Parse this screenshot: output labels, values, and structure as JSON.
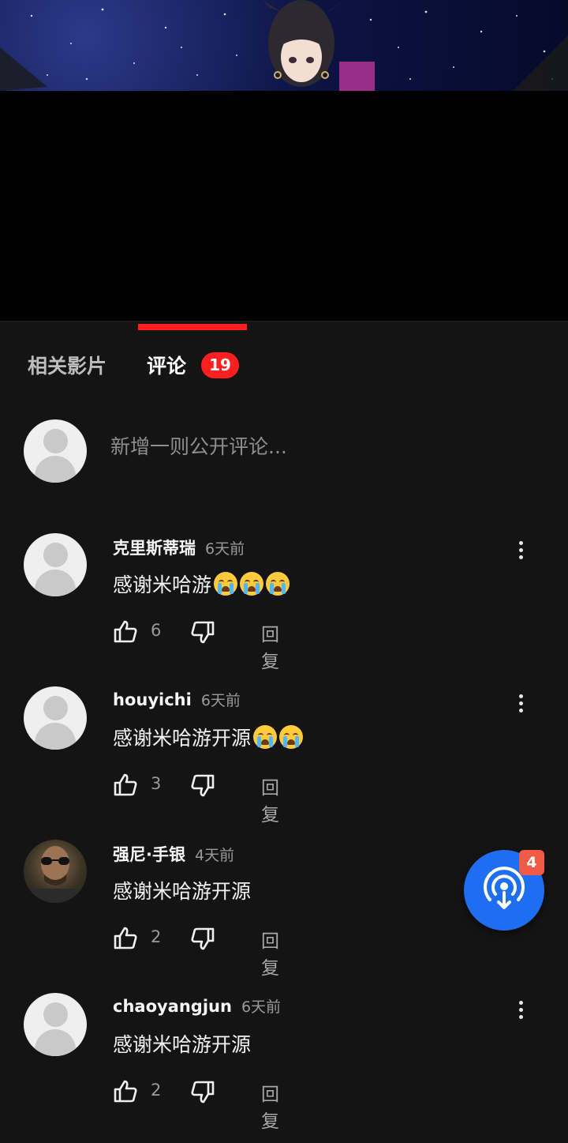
{
  "tabs": {
    "related": "相关影片",
    "comments": "评论",
    "comment_count": "19"
  },
  "compose": {
    "placeholder": "新增一则公开评论..."
  },
  "comments": [
    {
      "author": "克里斯蒂瑞",
      "time": "6天前",
      "text": "感谢米哈游",
      "emoji_count": 3,
      "likes": "6",
      "reply": "回复",
      "avatar": "default-avatar"
    },
    {
      "author": "houyichi",
      "time": "6天前",
      "text": "感谢米哈游开源",
      "emoji_count": 2,
      "likes": "3",
      "reply": "回复",
      "avatar": "default-avatar"
    },
    {
      "author": "强尼·手银",
      "time": "4天前",
      "text": "感谢米哈游开源",
      "emoji_count": 0,
      "likes": "2",
      "reply": "回复",
      "avatar": "photo-avatar"
    },
    {
      "author": "chaoyangjun",
      "time": "6天前",
      "text": "感谢米哈游开源",
      "emoji_count": 0,
      "likes": "2",
      "reply": "回复",
      "avatar": "default-avatar"
    }
  ],
  "fab": {
    "icon": "broadcast-download-icon",
    "badge": "4"
  },
  "colors": {
    "accent": "#ff1e1e",
    "fab": "#1e6ef2",
    "fab_badge": "#f05a47",
    "background": "#141414"
  }
}
